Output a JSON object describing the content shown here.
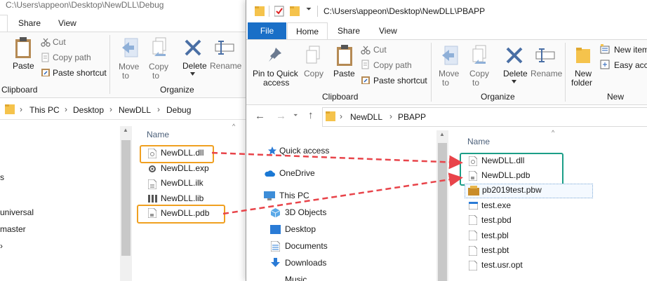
{
  "back_window": {
    "title": "C:\\Users\\appeon\\Desktop\\NewDLL\\Debug",
    "tabs": [
      "Share",
      "View"
    ],
    "ribbon": {
      "paste": "Paste",
      "cut": "Cut",
      "copy_path": "Copy path",
      "paste_shortcut": "Paste shortcut",
      "move_to": [
        "Move",
        "to"
      ],
      "copy_to": [
        "Copy",
        "to"
      ],
      "delete": "Delete",
      "rename": "Rename",
      "group_clipboard": "Clipboard",
      "group_organize": "Organize"
    },
    "breadcrumb": [
      "This PC",
      "Desktop",
      "NewDLL",
      "Debug"
    ],
    "nav_partial": [
      "s",
      "universal",
      "master"
    ],
    "column_name": "Name",
    "files": [
      "NewDLL.dll",
      "NewDLL.exp",
      "NewDLL.ilk",
      "NewDLL.lib",
      "NewDLL.pdb"
    ]
  },
  "front_window": {
    "title": "C:\\Users\\appeon\\Desktop\\NewDLL\\PBAPP",
    "tabs": [
      "File",
      "Home",
      "Share",
      "View"
    ],
    "ribbon": {
      "pin": [
        "Pin to Quick",
        "access"
      ],
      "copy": "Copy",
      "paste": "Paste",
      "cut": "Cut",
      "copy_path": "Copy path",
      "paste_shortcut": "Paste shortcut",
      "move_to": [
        "Move",
        "to"
      ],
      "copy_to": [
        "Copy",
        "to"
      ],
      "delete": "Delete",
      "rename": "Rename",
      "new_folder": [
        "New",
        "folder"
      ],
      "new_item": "New item",
      "easy_access": "Easy acce",
      "group_clipboard": "Clipboard",
      "group_organize": "Organize",
      "group_new": "New"
    },
    "breadcrumb": [
      "NewDLL",
      "PBAPP"
    ],
    "nav": [
      "Quick access",
      "OneDrive",
      "This PC",
      "3D Objects",
      "Desktop",
      "Documents",
      "Downloads",
      "Music"
    ],
    "column_name": "Name",
    "files": [
      "NewDLL.dll",
      "NewDLL.pdb",
      "pb2019test.pbw",
      "test.exe",
      "test.pbd",
      "test.pbl",
      "test.pbt",
      "test.usr.opt"
    ]
  },
  "colors": {
    "highlight_orange": "#f0a020",
    "highlight_teal": "#1b9e88",
    "arrow_red": "#e8444a",
    "file_tab": "#1a6fc7",
    "folder_yellow": "#f5c34c"
  }
}
